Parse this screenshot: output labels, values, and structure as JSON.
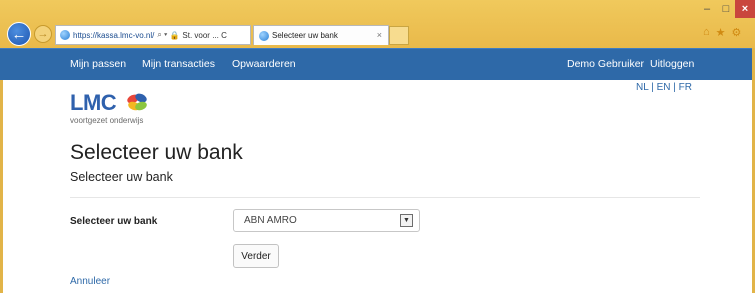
{
  "browser": {
    "url_host": "https://kassa.lmc-vo.nl/",
    "url_suffix": "",
    "address_icons": "⌕ ▾ ",
    "cert_label": "St. voor ... C",
    "tab_title": "Selecteer uw bank",
    "tab_close": "×",
    "window_controls": {
      "minimize": "–",
      "maximize": "□",
      "close": "×"
    },
    "toolbar_icons": [
      "home-icon",
      "star-icon",
      "gear-icon"
    ]
  },
  "navbar": {
    "my_passes": "Mijn passen",
    "my_transactions": "Mijn transacties",
    "top_up": "Opwaarderen",
    "user": "Demo Gebruiker",
    "logout": "Uitloggen"
  },
  "languages": "NL | EN | FR",
  "logo": {
    "text": "LMC",
    "subtitle": "voortgezet onderwijs"
  },
  "page": {
    "title": "Selecteer uw bank",
    "subtitle": "Selecteer uw bank"
  },
  "form": {
    "bank_label": "Selecteer uw bank",
    "bank_selected": "ABN AMRO",
    "next_label": "Verder",
    "cancel_label": "Annuleer"
  },
  "colors": {
    "navbar": "#2e69a8",
    "chrome": "#e9b94a",
    "link": "#2e69a8"
  }
}
